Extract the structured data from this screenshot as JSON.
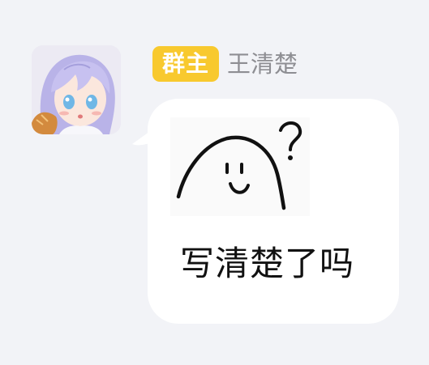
{
  "sender": {
    "role_badge": "群主",
    "name": "王清楚",
    "badge_color": "#f8c92e",
    "name_color": "#8e8e93"
  },
  "message": {
    "text": "写清楚了吗",
    "bubble_color": "#ffffff"
  },
  "background_color": "#f2f3f7",
  "icons": {
    "avatar": "anime-girl-avatar",
    "sticker": "confused-blob-sticker"
  }
}
